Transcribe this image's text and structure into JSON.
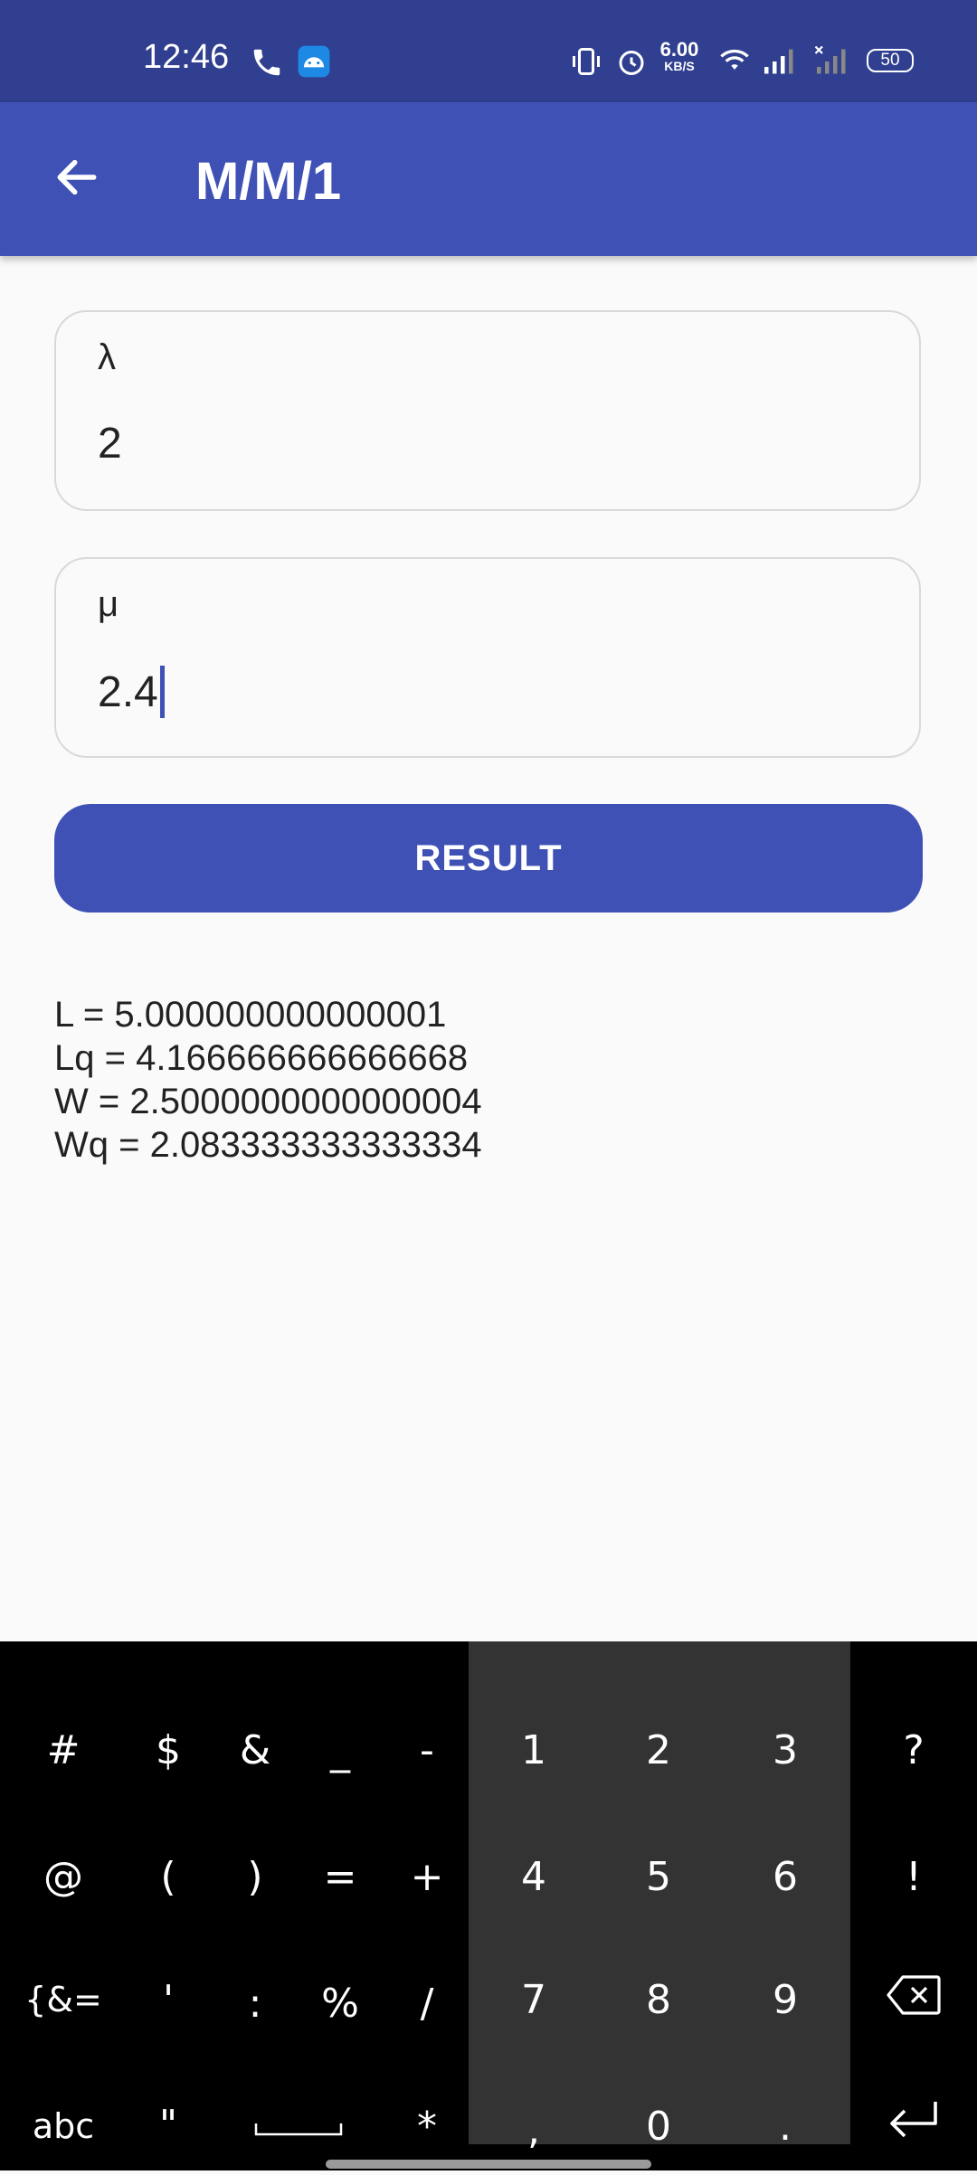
{
  "status_bar": {
    "time": "12:46",
    "network_speed": "6.00",
    "network_unit": "KB/S",
    "battery": "50",
    "icons": [
      "phone-icon",
      "android-app-icon",
      "vibrate-icon",
      "alarm-icon",
      "wifi-icon",
      "signal-icon",
      "signal-off-icon",
      "battery-icon"
    ]
  },
  "app_bar": {
    "title": "M/M/1",
    "back_icon": "arrow-left-icon"
  },
  "form": {
    "lambda": {
      "label": "λ",
      "value": "2"
    },
    "mu": {
      "label": "μ",
      "value": "2.4"
    },
    "result_button": "RESULT"
  },
  "results": {
    "L": "L = 5.000000000000001",
    "Lq": "Lq = 4.166666666666668",
    "W": "W = 2.5000000000000004",
    "Wq": "Wq = 2.083333333333334"
  },
  "keyboard": {
    "row1": [
      "#",
      "$",
      "&",
      "_",
      "-",
      "1",
      "2",
      "3",
      "?"
    ],
    "row2": [
      "@",
      "(",
      ")",
      "=",
      "+",
      "4",
      "5",
      "6",
      "!"
    ],
    "row3": [
      "{&=",
      "'",
      ":",
      "%",
      "/",
      "7",
      "8",
      "9"
    ],
    "row4": [
      "abc",
      "\"",
      "*",
      ",",
      "0",
      "."
    ],
    "backspace_icon": "backspace-icon",
    "enter_icon": "enter-icon",
    "space_icon": "space-icon"
  },
  "colors": {
    "primary": "#3f51b5",
    "primary_dark": "#303f8f",
    "keyboard_bg": "#000000",
    "numpad_bg": "#333333"
  }
}
